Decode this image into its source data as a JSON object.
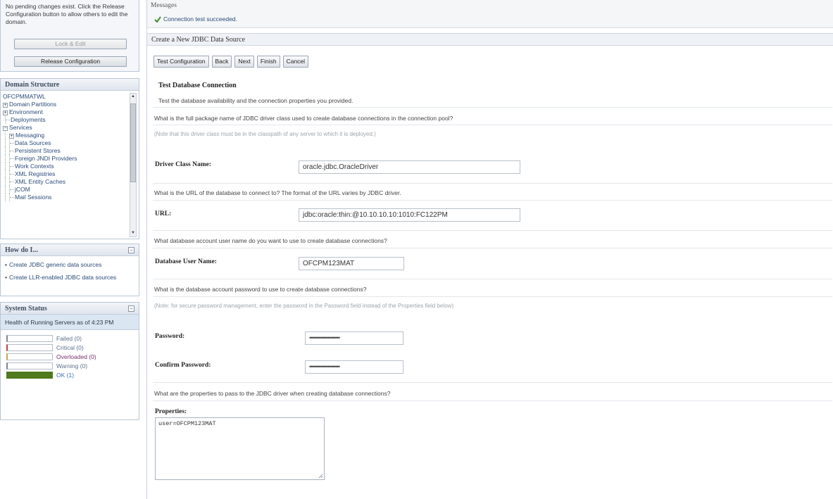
{
  "change_center": {
    "info": "No pending changes exist. Click the Release Configuration button to allow others to edit the domain.",
    "lock_edit_label": "Lock & Edit",
    "release_label": "Release Configuration"
  },
  "domain_structure": {
    "title": "Domain Structure",
    "root": "OFCPMMATWL",
    "items": [
      {
        "label": "Domain Partitions",
        "level": 0,
        "expander": "+"
      },
      {
        "label": "Environment",
        "level": 0,
        "expander": "+"
      },
      {
        "label": "Deployments",
        "level": 0,
        "expander": ""
      },
      {
        "label": "Services",
        "level": 0,
        "expander": "-"
      },
      {
        "label": "Messaging",
        "level": 1,
        "expander": "+"
      },
      {
        "label": "Data Sources",
        "level": 1,
        "expander": ""
      },
      {
        "label": "Persistent Stores",
        "level": 1,
        "expander": ""
      },
      {
        "label": "Foreign JNDI Providers",
        "level": 1,
        "expander": ""
      },
      {
        "label": "Work Contexts",
        "level": 1,
        "expander": ""
      },
      {
        "label": "XML Registries",
        "level": 1,
        "expander": ""
      },
      {
        "label": "XML Entity Caches",
        "level": 1,
        "expander": ""
      },
      {
        "label": "jCOM",
        "level": 1,
        "expander": ""
      },
      {
        "label": "Mail Sessions",
        "level": 1,
        "expander": ""
      }
    ]
  },
  "how_do_i": {
    "title": "How do I...",
    "links": [
      "Create JDBC generic data sources",
      "Create LLR-enabled JDBC data sources"
    ]
  },
  "system_status": {
    "title": "System Status",
    "health": "Health of Running Servers as of  4:23 PM",
    "items": [
      {
        "key": "failed",
        "label": "Failed (0)",
        "value": 0
      },
      {
        "key": "critical",
        "label": "Critical (0)",
        "value": 0
      },
      {
        "key": "overloaded",
        "label": "Overloaded (0)",
        "value": 0
      },
      {
        "key": "warning",
        "label": "Warning (0)",
        "value": 0
      },
      {
        "key": "ok",
        "label": "OK (1)",
        "value": 1
      }
    ]
  },
  "messages": {
    "header": "Messages",
    "text": "Connection test succeeded."
  },
  "page_title": "Create a New JDBC Data Source",
  "toolbar": {
    "test_label": "Test Configuration",
    "back_label": "Back",
    "next_label": "Next",
    "finish_label": "Finish",
    "cancel_label": "Cancel"
  },
  "section": {
    "title": "Test Database Connection",
    "desc": "Test the database availability and the connection properties you provided."
  },
  "form": {
    "driver_q": "What is the full package name of JDBC driver class used to create database connections in the connection pool?",
    "driver_note": "(Note that this driver class must be in the classpath of any server to which it is deployed.)",
    "driver_label": "Driver Class Name:",
    "driver_value": "oracle.jdbc.OracleDriver",
    "url_q": "What is the URL of the database to connect to? The format of the URL varies by JDBC driver.",
    "url_label": "URL:",
    "url_value": "jdbc:oracle:thin:@10.10.10.10:1010:FC122PM",
    "user_q": "What database account user name do you want to use to create database connections?",
    "user_label": "Database User Name:",
    "user_value": "OFCPM123MAT",
    "pw_q": "What is the database account password to use to create database connections?",
    "pw_note": "(Note: for secure password management, enter the password in the Password field instead of the Properties field below)",
    "pw_label": "Password:",
    "pw_value": "••••••••••••••••••••",
    "confirm_label": "Confirm Password:",
    "confirm_value": "••••••••••••••••••••",
    "props_q": "What are the properties to pass to the JDBC driver when creating database connections?",
    "props_label": "Properties:",
    "props_value": "user=OFCPM123MAT"
  }
}
